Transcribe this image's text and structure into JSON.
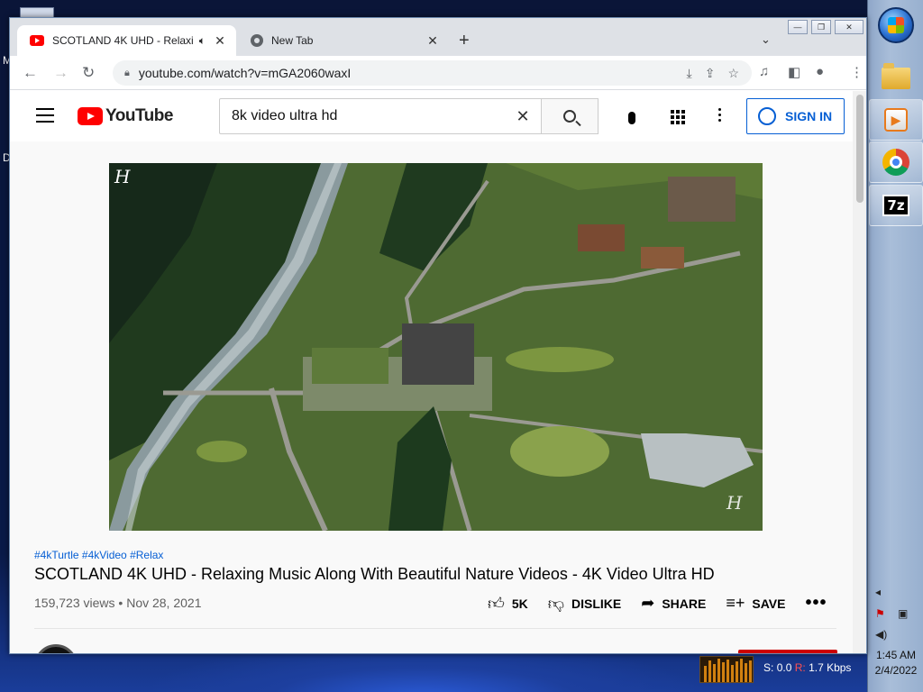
{
  "desktop": {
    "labels": [
      "M",
      "D"
    ],
    "net_stats": {
      "sent_label": "S:",
      "sent": "0.0",
      "recv_label": "R:",
      "recv": "1.7 Kbps"
    }
  },
  "taskbar": {
    "apps": [
      "folder-icon",
      "media-player-icon",
      "chrome-icon",
      "7zip-icon"
    ],
    "seven_zip_label": "7z",
    "clock": {
      "time": "1:45 AM",
      "date": "2/4/2022"
    }
  },
  "browser": {
    "tabs": [
      {
        "title": "SCOTLAND 4K UHD - Relaxi",
        "active": true,
        "audio": true
      },
      {
        "title": "New Tab",
        "active": false
      }
    ],
    "new_tab_glyph": "+",
    "close_glyph": "✕",
    "url": "youtube.com/watch?v=mGA2060waxI"
  },
  "youtube": {
    "logo_text": "YouTube",
    "search": {
      "query": "8k video ultra hd"
    },
    "signin_label": "SIGN IN",
    "video": {
      "watermark": "H",
      "hashtags": "#4kTurtle #4kVideo #Relax",
      "title": "SCOTLAND 4K UHD - Relaxing Music Along With Beautiful Nature Videos - 4K Video Ultra HD",
      "views": "159,723 views",
      "date": "Nov 28, 2021",
      "like_count": "5K",
      "dislike_label": "DISLIKE",
      "share_label": "SHARE",
      "save_label": "SAVE",
      "more_glyph": "•••"
    }
  }
}
